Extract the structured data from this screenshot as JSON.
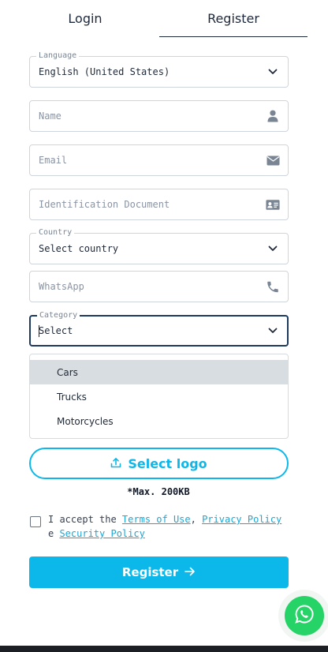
{
  "tabs": {
    "login": "Login",
    "register": "Register",
    "active": "Register"
  },
  "form": {
    "language": {
      "label": "Language",
      "value": "English (United States)"
    },
    "name": {
      "placeholder": "Name",
      "icon": "user-icon"
    },
    "email": {
      "placeholder": "Email",
      "icon": "envelope-icon"
    },
    "id_document": {
      "placeholder": "Identification Document",
      "icon": "id-card-icon"
    },
    "country": {
      "label": "Country",
      "value": "Select country"
    },
    "whatsapp": {
      "placeholder": "WhatsApp",
      "icon": "phone-icon"
    },
    "category": {
      "label": "Category",
      "value": "Select",
      "options": [
        "Cars",
        "Trucks",
        "Motorcycles"
      ],
      "highlighted": "Cars"
    }
  },
  "upload": {
    "label": "Select logo",
    "icon": "upload-icon",
    "max_size": "*Max. 200KB"
  },
  "terms": {
    "prefix": "I accept the ",
    "terms_link": "Terms of Use",
    "sep": ", ",
    "privacy_link": "Privacy Policy",
    "conj": "e ",
    "security_link": "Security Policy"
  },
  "register_button": {
    "label": "Register",
    "icon": "arrow-right-icon"
  },
  "whatsapp_fab": {
    "icon": "whatsapp-icon"
  },
  "colors": {
    "accent": "#0cb8ea",
    "whatsapp": "#25d366",
    "text": "#1e293b"
  }
}
